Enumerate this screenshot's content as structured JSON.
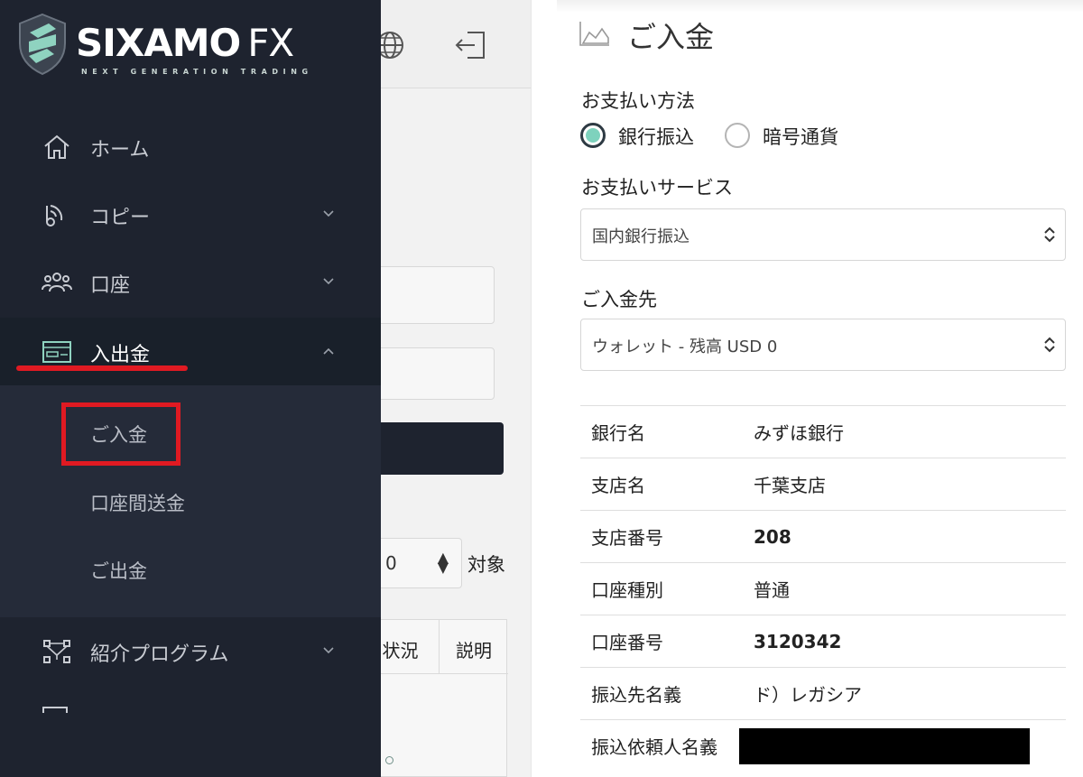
{
  "brand": {
    "name": "SIXAMO",
    "suffix": "FX",
    "tagline": "NEXT GENERATION TRADING"
  },
  "sidebar": {
    "items": [
      {
        "label": "ホーム",
        "icon": "home-icon"
      },
      {
        "label": "コピー",
        "icon": "copy-signal-icon"
      },
      {
        "label": "口座",
        "icon": "accounts-icon"
      },
      {
        "label": "入出金",
        "icon": "card-icon"
      },
      {
        "label": "紹介プログラム",
        "icon": "referral-network-icon"
      }
    ],
    "submenu": [
      "ご入金",
      "口座間送金",
      "ご出金"
    ]
  },
  "background_page": {
    "select_value": "0",
    "target_label": "対象",
    "columns": [
      "状況",
      "説明"
    ]
  },
  "deposit": {
    "title": "ご入金",
    "payment_method_label": "お支払い方法",
    "payment_methods": [
      {
        "label": "銀行振込",
        "checked": true
      },
      {
        "label": "暗号通貨",
        "checked": false
      }
    ],
    "service_label": "お支払いサービス",
    "service_value": "国内銀行振込",
    "destination_label": "ご入金先",
    "destination_value": "ウォレット - 残高 USD 0",
    "bank_details": [
      {
        "key": "銀行名",
        "value": "みずほ銀行"
      },
      {
        "key": "支店名",
        "value": "千葉支店"
      },
      {
        "key": "支店番号",
        "value": "208"
      },
      {
        "key": "口座種別",
        "value": "普通"
      },
      {
        "key": "口座番号",
        "value": "3120342"
      },
      {
        "key": "振込先名義",
        "value": "ド）レガシア"
      },
      {
        "key": "振込依頼人名義",
        "value": ""
      }
    ]
  },
  "colors": {
    "sidebar_bg": "#1e232f",
    "highlight_red": "#e01a22",
    "accent_teal": "#7ed2bd"
  }
}
